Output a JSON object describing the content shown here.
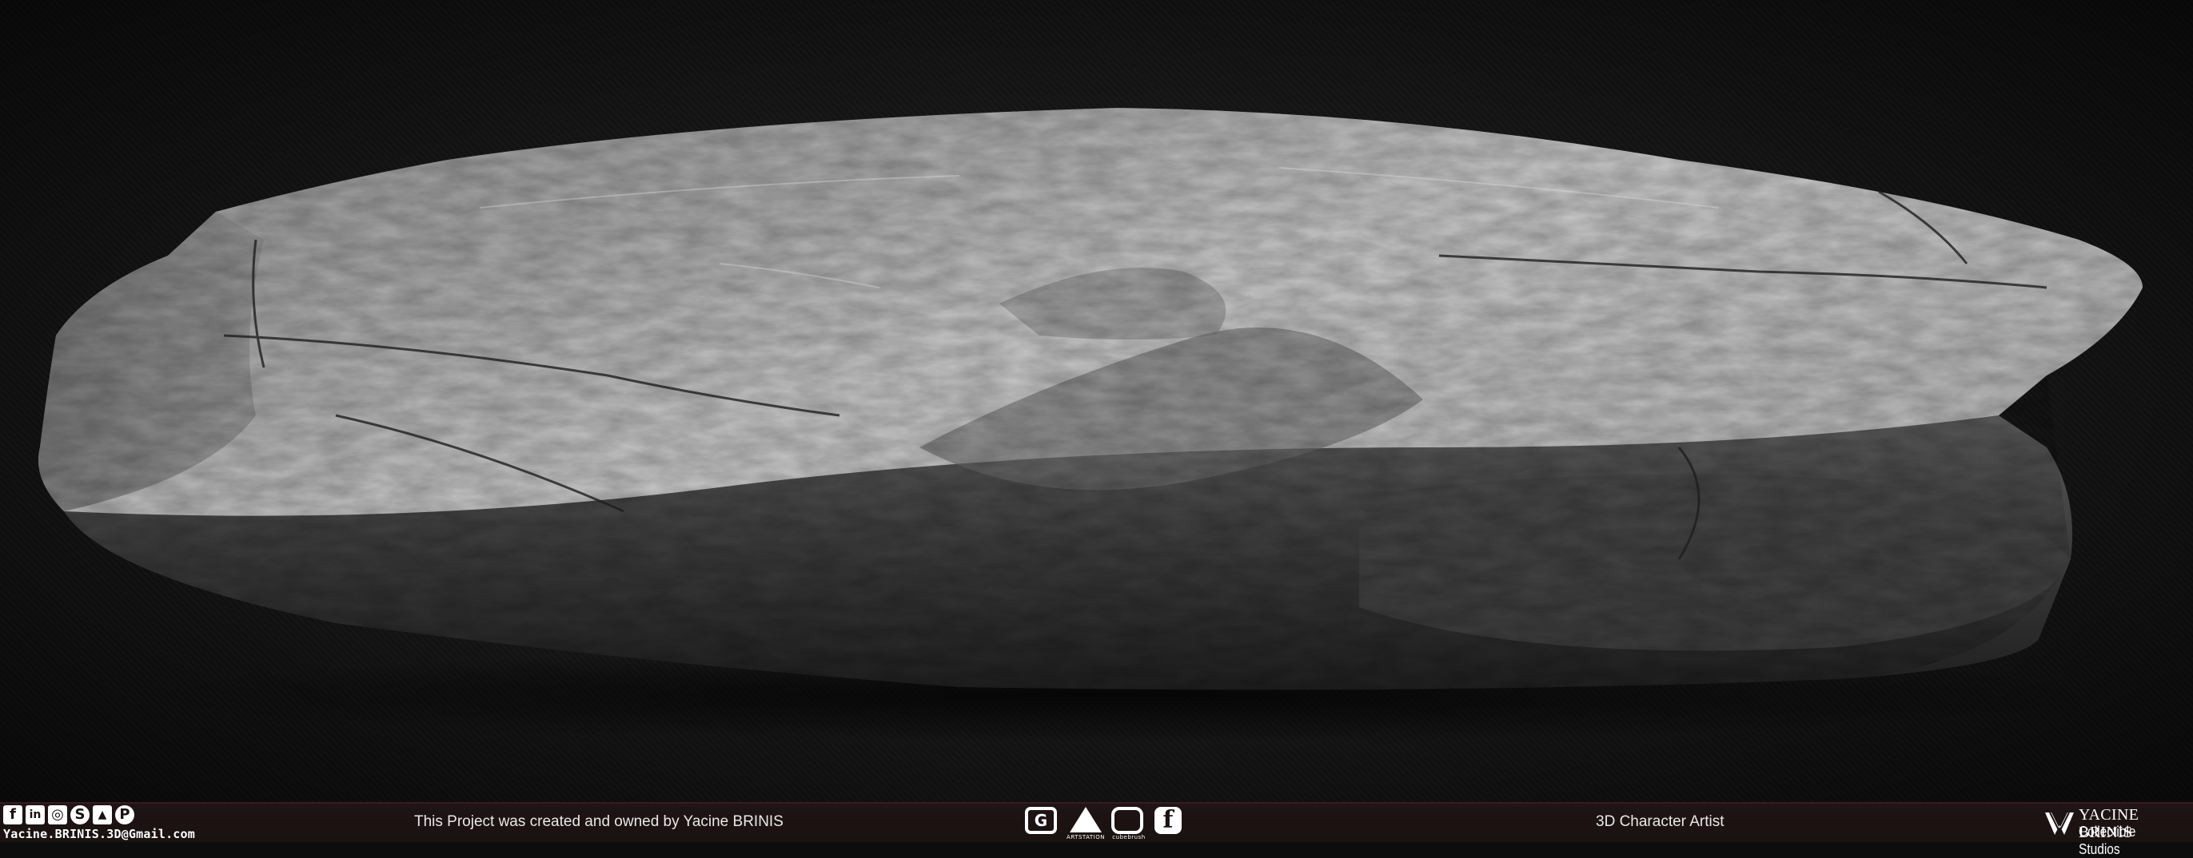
{
  "footer": {
    "social_icons": [
      "facebook-icon",
      "linkedin-icon",
      "instagram-icon",
      "skype-icon",
      "artstation-icon",
      "pinterest-icon"
    ],
    "social_glyphs": [
      "f",
      "in",
      "◎",
      "S",
      "▲",
      "P"
    ],
    "email": "Yacine.BRINIS.3D@Gmail.com",
    "credit": "This Project was created and owned by Yacine BRINIS",
    "tools": [
      {
        "icon": "gumroad-icon",
        "glyph": "G",
        "caption": ""
      },
      {
        "icon": "artstation-icon",
        "glyph": "",
        "caption": "ARTSTATION"
      },
      {
        "icon": "cubebrush-icon",
        "glyph": "",
        "caption": "cubebrush"
      },
      {
        "icon": "flippednormals-icon",
        "glyph": "f",
        "caption": ""
      }
    ],
    "role": "3D Character Artist",
    "brand": {
      "name": "YACINE BRINIS",
      "studio": "Collectible Studios"
    }
  },
  "colors": {
    "background": "#1a1a1a",
    "footer": "#1c1212",
    "footer_border": "#3a1c1c",
    "rock_light": "#c9c9c9",
    "rock_mid": "#8a8a8a",
    "rock_dark": "#2b2b2b"
  }
}
